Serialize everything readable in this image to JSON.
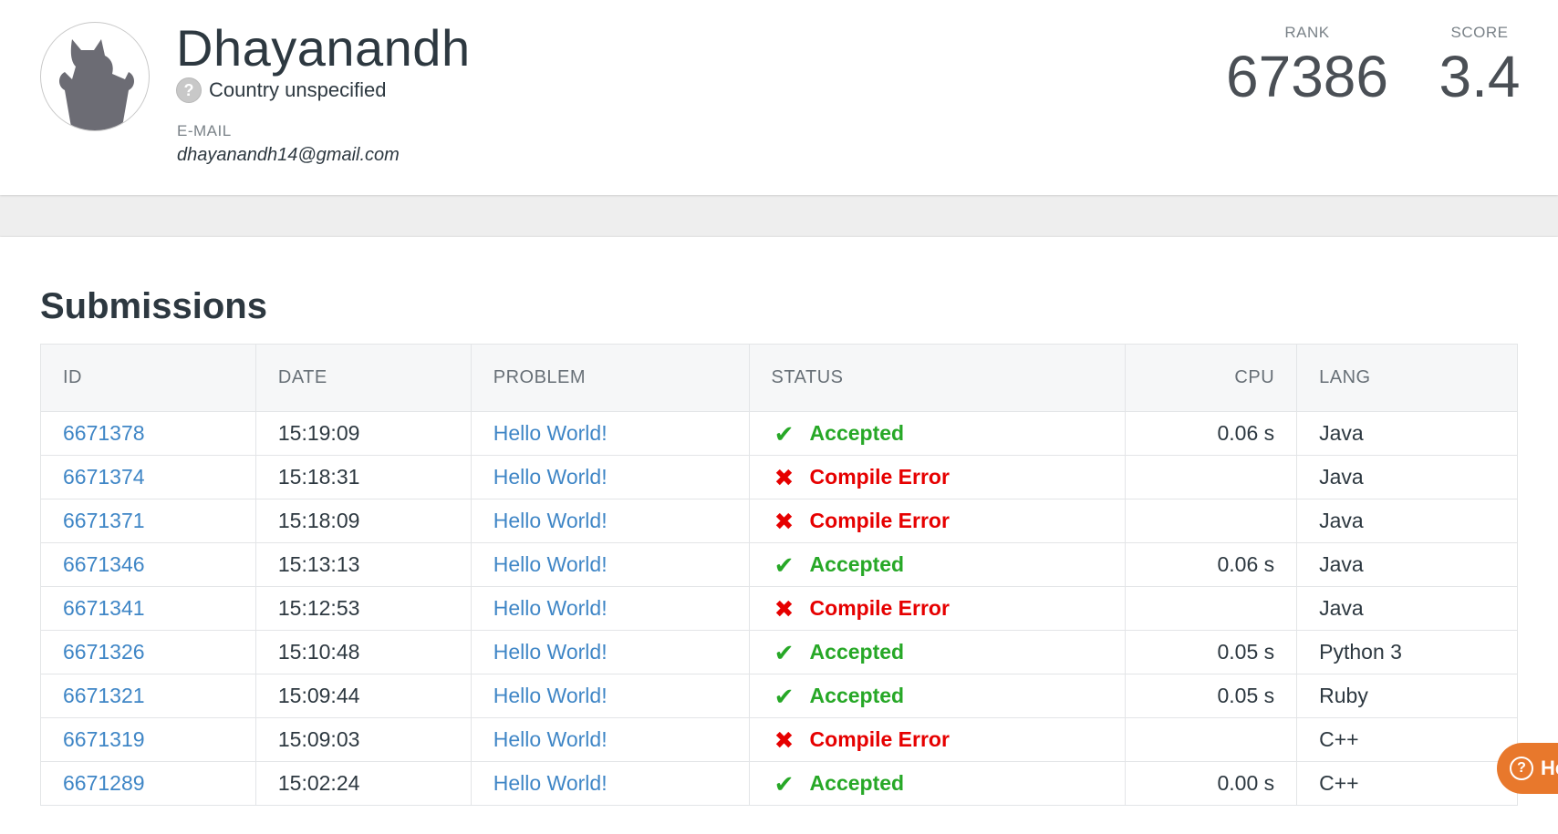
{
  "profile": {
    "name": "Dhayanandh",
    "country": "Country unspecified",
    "email_label": "E-MAIL",
    "email": "dhayanandh14@gmail.com",
    "rank_label": "RANK",
    "rank": "67386",
    "score_label": "SCORE",
    "score": "3.4"
  },
  "submissions": {
    "title": "Submissions",
    "columns": [
      "ID",
      "DATE",
      "PROBLEM",
      "STATUS",
      "CPU",
      "LANG"
    ],
    "rows": [
      {
        "id": "6671378",
        "date": "15:19:09",
        "problem": "Hello World!",
        "status": "Accepted",
        "ok": true,
        "cpu": "0.06 s",
        "lang": "Java"
      },
      {
        "id": "6671374",
        "date": "15:18:31",
        "problem": "Hello World!",
        "status": "Compile Error",
        "ok": false,
        "cpu": "",
        "lang": "Java"
      },
      {
        "id": "6671371",
        "date": "15:18:09",
        "problem": "Hello World!",
        "status": "Compile Error",
        "ok": false,
        "cpu": "",
        "lang": "Java"
      },
      {
        "id": "6671346",
        "date": "15:13:13",
        "problem": "Hello World!",
        "status": "Accepted",
        "ok": true,
        "cpu": "0.06 s",
        "lang": "Java"
      },
      {
        "id": "6671341",
        "date": "15:12:53",
        "problem": "Hello World!",
        "status": "Compile Error",
        "ok": false,
        "cpu": "",
        "lang": "Java"
      },
      {
        "id": "6671326",
        "date": "15:10:48",
        "problem": "Hello World!",
        "status": "Accepted",
        "ok": true,
        "cpu": "0.05 s",
        "lang": "Python 3"
      },
      {
        "id": "6671321",
        "date": "15:09:44",
        "problem": "Hello World!",
        "status": "Accepted",
        "ok": true,
        "cpu": "0.05 s",
        "lang": "Ruby"
      },
      {
        "id": "6671319",
        "date": "15:09:03",
        "problem": "Hello World!",
        "status": "Compile Error",
        "ok": false,
        "cpu": "",
        "lang": "C++"
      },
      {
        "id": "6671289",
        "date": "15:02:24",
        "problem": "Hello World!",
        "status": "Accepted",
        "ok": true,
        "cpu": "0.00 s",
        "lang": "C++"
      }
    ]
  },
  "help_button": {
    "label": "He",
    "icon": "question-circle-icon"
  },
  "colors": {
    "accepted": "#27a827",
    "error": "#e60000",
    "link": "#3f86c6",
    "help": "#e8782c"
  }
}
